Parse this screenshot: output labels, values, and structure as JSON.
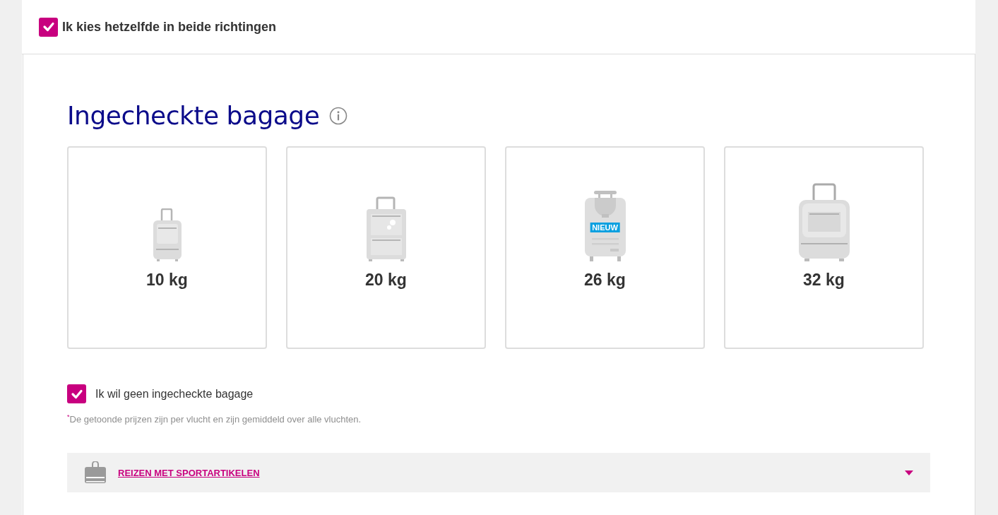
{
  "same_both_directions": {
    "label": "Ik kies hetzelfde in beide richtingen",
    "checked": true
  },
  "section": {
    "title": "Ingecheckte bagage"
  },
  "options": [
    {
      "kind": "small",
      "weight": "10 kg"
    },
    {
      "kind": "medium",
      "weight": "20 kg"
    },
    {
      "kind": "tall",
      "weight": "26 kg",
      "badge": "NIEUW"
    },
    {
      "kind": "large",
      "weight": "32 kg"
    }
  ],
  "no_bag": {
    "label": "Ik wil geen ingecheckte bagage",
    "checked": true
  },
  "footnote": "$^{*}$De getoonde prijzen zijn per vlucht en zijn gemiddeld over alle vluchten.",
  "accordion": {
    "label": "REIZEN MET SPORTARTIKELEN",
    "expanded": false
  }
}
